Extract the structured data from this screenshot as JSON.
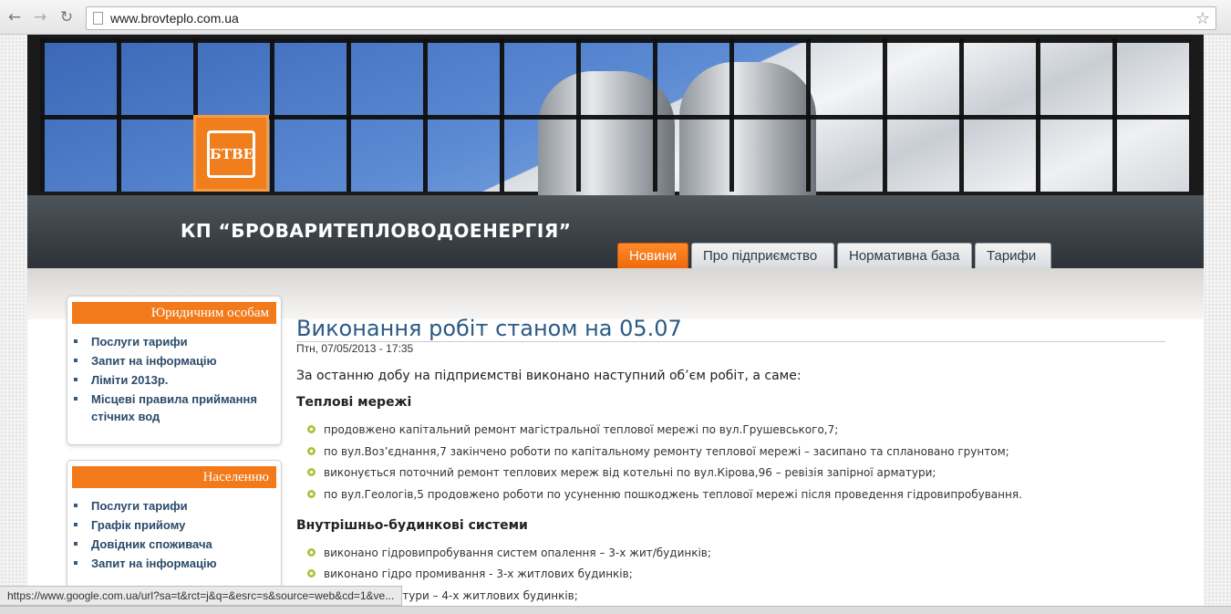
{
  "browser": {
    "url": "www.brovteplo.com.ua",
    "status_url": "https://www.google.com.ua/url?sa=t&rct=j&q=&esrc=s&source=web&cd=1&ve..."
  },
  "header": {
    "company_name": "КП “БРОВАРИТЕПЛОВОДОЕНЕРГІЯ”",
    "logo_text": "БТВЕ",
    "tabs": [
      {
        "label": "Новини"
      },
      {
        "label": "Про підприємство"
      },
      {
        "label": "Нормативна база"
      },
      {
        "label": "Тарифи"
      }
    ]
  },
  "sidebar": {
    "blocks": [
      {
        "title": "Юридичним особам",
        "items": [
          "Послуги тарифи",
          "Запит на інформацію",
          "Ліміти 2013р.",
          "Місцеві правила приймання стічних вод"
        ]
      },
      {
        "title": "Населенню",
        "items": [
          "Послуги тарифи",
          "Графік прийому",
          "Довідник споживача",
          "Запит на інформацію"
        ]
      }
    ]
  },
  "article": {
    "title": "Виконання робіт станом на 05.07",
    "date": "Птн, 07/05/2013 - 17:35",
    "intro": "За останню добу на підприємстві виконано наступний об’єм робіт, а саме:",
    "sections": [
      {
        "title": "Теплові мережі",
        "items": [
          "продовжено капітальний ремонт магістральної теплової мережі по вул.Грушевського,7;",
          "по вул.Воз’єднання,7 закінчено роботи по капітальному ремонту теплової мережі – засипано та сплановано грунтом;",
          "виконується поточний ремонт теплових мереж від котельні по вул.Кірова,96 – ревізія запірної арматури;",
          "по вул.Геологів,5 продовжено роботи по усуненню пошкоджень теплової мережі після проведення гідровипробування."
        ]
      },
      {
        "title": "Внутрішньо-будинкові системи",
        "items": [
          "виконано гідровипробування систем опалення – 3-х жит/будинків;",
          "виконано гідро промивання - 3-х житлових будинків;",
          "запірної арматури – 4-х житлових будинків;"
        ]
      }
    ]
  }
}
